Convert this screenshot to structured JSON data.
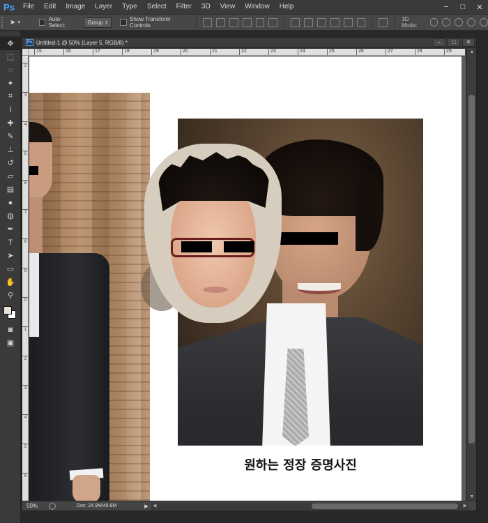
{
  "app": {
    "logo": "Ps",
    "menu": [
      "File",
      "Edit",
      "Image",
      "Layer",
      "Type",
      "Select",
      "Filter",
      "3D",
      "View",
      "Window",
      "Help"
    ],
    "window_controls": [
      "−",
      "□",
      "✕"
    ]
  },
  "options_bar": {
    "auto_select_label": "Auto-Select:",
    "auto_select_value": "Group",
    "show_transform_label": "Show Transform Controls",
    "mode_3d_label": "3D Mode:"
  },
  "document": {
    "title": "Untitled-1 @ 50% (Layer 5, RGB/8) *",
    "ruler_h": [
      "15",
      "16",
      "17",
      "18",
      "19",
      "20",
      "21",
      "22",
      "23",
      "24",
      "25",
      "26",
      "27",
      "28",
      "29"
    ],
    "ruler_v": [
      "2",
      "3",
      "4",
      "5",
      "6",
      "7",
      "8",
      "9",
      "0",
      "1",
      "2",
      "3",
      "4",
      "5",
      "6"
    ],
    "caption": "원하는 정장 증명사진",
    "zoom": "50%",
    "doc_info": "Doc: 24.9M/49.8M"
  },
  "toolbar": {
    "tools": [
      "move-tool",
      "marquee-tool",
      "lasso-tool",
      "magic-wand-tool",
      "crop-tool",
      "eyedropper-tool",
      "healing-tool",
      "brush-tool",
      "clone-stamp-tool",
      "history-brush-tool",
      "eraser-tool",
      "gradient-tool",
      "blur-tool",
      "dodge-tool",
      "pen-tool",
      "type-tool",
      "path-selection-tool",
      "rectangle-tool",
      "hand-tool",
      "zoom-tool"
    ],
    "foreground_color": "#e9e2d8",
    "background_color": "#ffffff"
  }
}
